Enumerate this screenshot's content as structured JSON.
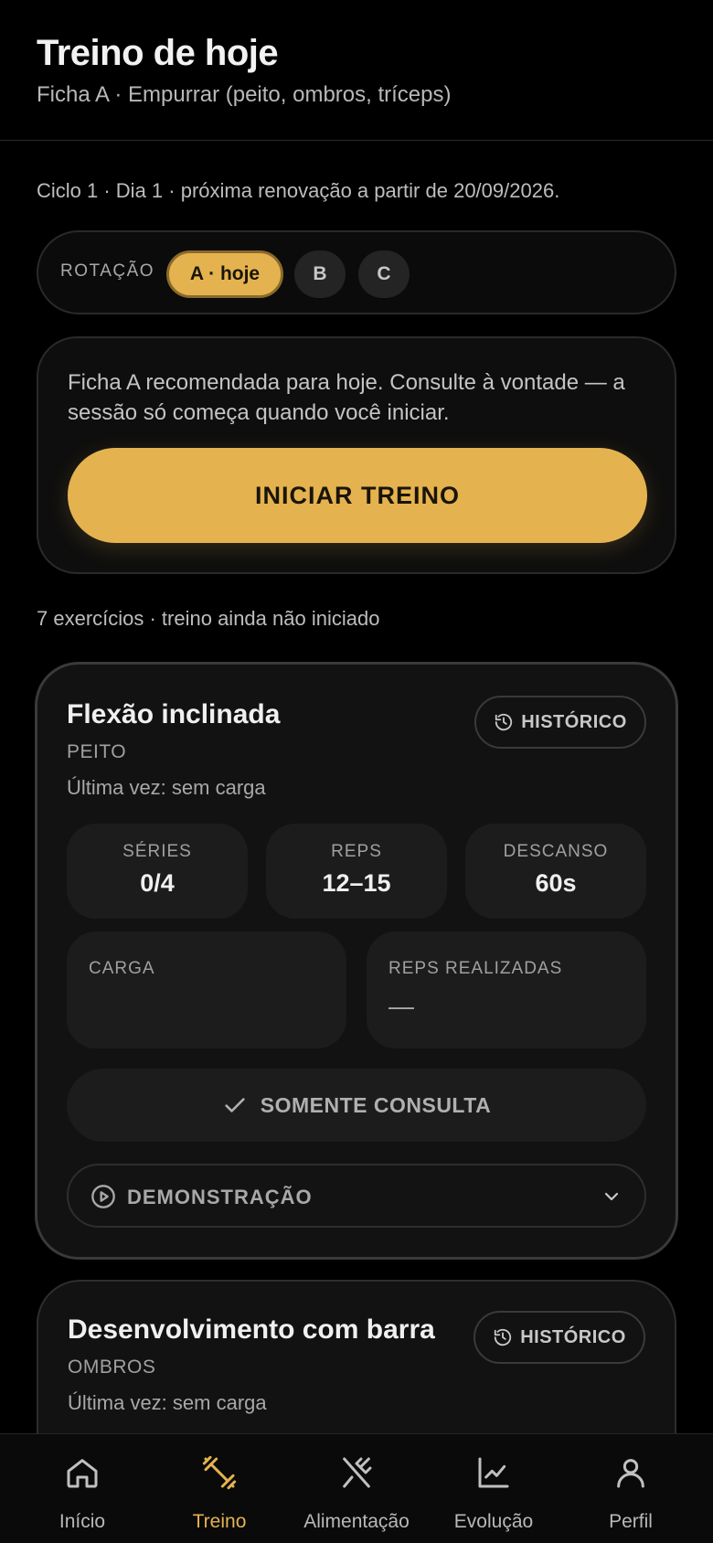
{
  "header": {
    "title": "Treino de hoje",
    "subtitle": "Ficha A · Empurrar (peito, ombros, tríceps)"
  },
  "cycle_text": "Ciclo 1 · Dia 1 · próxima renovação a partir de 20/09/2026.",
  "rotation": {
    "label": "ROTAÇÃO",
    "options": [
      "A · hoje",
      "B",
      "C"
    ],
    "selected": "A · hoje"
  },
  "start_card": {
    "text": "Ficha A recomendada para hoje. Consulte à vontade — a sessão só começa quando você iniciar.",
    "button_label": "INICIAR TREINO"
  },
  "status_text": "7 exercícios · treino ainda não iniciado",
  "exercises": [
    {
      "name": "Flexão inclinada",
      "group": "PEITO",
      "last": "Última vez: sem carga",
      "history_label": "HISTÓRICO",
      "stats": [
        {
          "label": "SÉRIES",
          "value": "0/4"
        },
        {
          "label": "REPS",
          "value": "12–15"
        },
        {
          "label": "DESCANSO",
          "value": "60s"
        }
      ],
      "load_label": "CARGA",
      "load_value": "",
      "reps_done_label": "REPS REALIZADAS",
      "reps_done_value": "—",
      "consult_label": "SOMENTE CONSULTA",
      "demo_label": "DEMONSTRAÇÃO"
    },
    {
      "name": "Desenvolvimento com barra",
      "group": "OMBROS",
      "last": "Última vez: sem carga",
      "history_label": "HISTÓRICO"
    }
  ],
  "nav": {
    "items": [
      {
        "label": "Início",
        "icon": "home-icon"
      },
      {
        "label": "Treino",
        "icon": "dumbbell-icon"
      },
      {
        "label": "Alimentação",
        "icon": "utensils-icon"
      },
      {
        "label": "Evolução",
        "icon": "chart-icon"
      },
      {
        "label": "Perfil",
        "icon": "user-icon"
      }
    ],
    "active": "Treino"
  },
  "colors": {
    "accent": "#e4b34f",
    "background": "#000000",
    "card": "#121212"
  }
}
